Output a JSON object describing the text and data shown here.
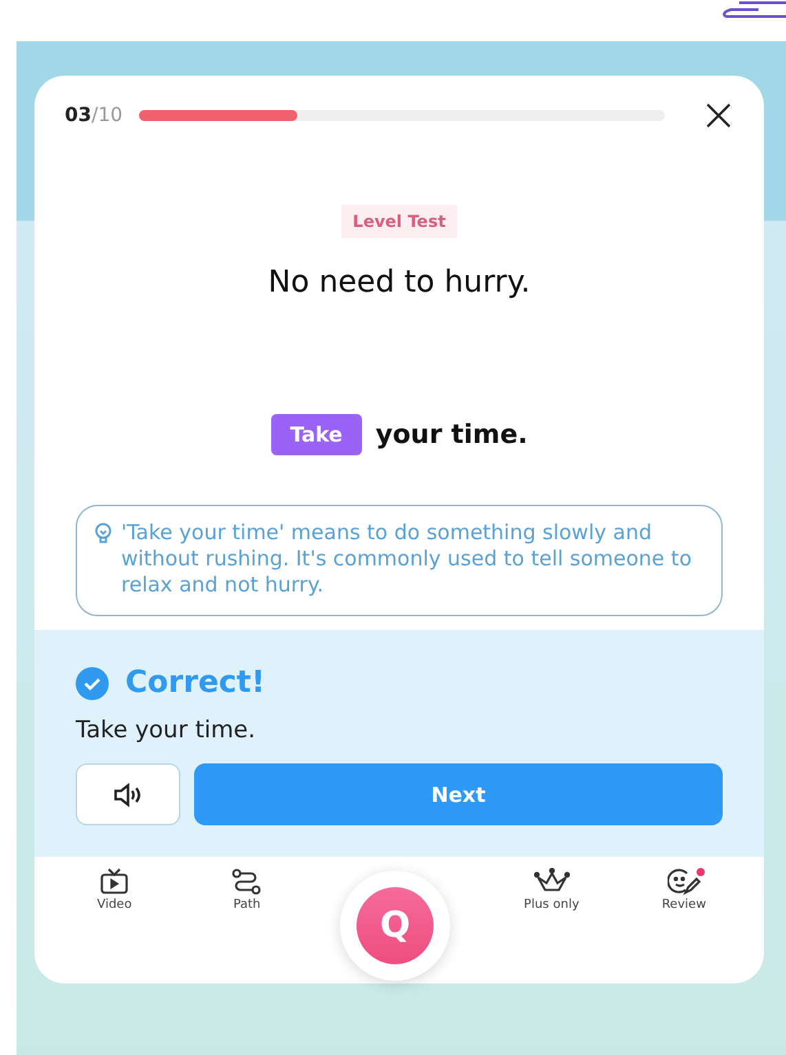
{
  "progress": {
    "current": "03",
    "total": "/10",
    "level": 0.3
  },
  "badge": "Level Test",
  "prompt": "No need to hurry.",
  "answer": [
    {
      "text": "Take",
      "kind": "chip"
    },
    {
      "text": "your time.",
      "kind": "plain"
    }
  ],
  "hint": "'Take your time' means to do something slowly and without rushing. It's commonly used to tell someone to relax and not hurry.",
  "result": {
    "title": "Correct!",
    "sentence": "Take your time.",
    "correct": true
  },
  "next_button": "Next",
  "center_button": "Q",
  "nav": [
    {
      "label": "Video",
      "kind": "video",
      "dot": false
    },
    {
      "label": "Path",
      "kind": "path",
      "dot": false
    },
    {
      "label": "Plus only",
      "kind": "crown",
      "dot": false
    },
    {
      "label": "Review",
      "kind": "review",
      "dot": true
    }
  ]
}
